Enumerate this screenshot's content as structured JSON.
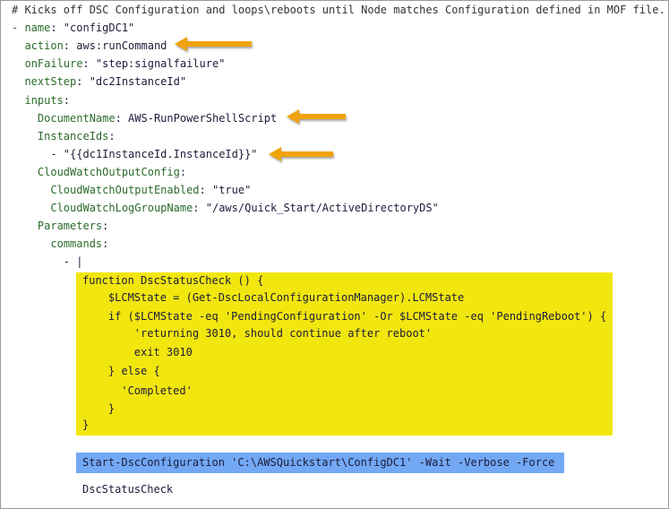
{
  "yaml_lines": [
    {
      "key": "",
      "val": "# Kicks off DSC Configuration and loops\\reboots until Node matches Configuration defined in MOF file."
    },
    {
      "key": "- name",
      "val": ": \"configDC1\""
    },
    {
      "key": "  action",
      "val": ": aws:runCommand"
    },
    {
      "key": "  onFailure",
      "val": ": \"step:signalfailure\""
    },
    {
      "key": "  nextStep",
      "val": ": \"dc2InstanceId\""
    },
    {
      "key": "  inputs",
      "val": ":"
    },
    {
      "key": "    DocumentName",
      "val": ": AWS-RunPowerShellScript"
    },
    {
      "key": "    InstanceIds",
      "val": ":"
    },
    {
      "key": "",
      "val": "      - \"{{dc1InstanceId.InstanceId}}\""
    },
    {
      "key": "    CloudWatchOutputConfig",
      "val": ":"
    },
    {
      "key": "      CloudWatchOutputEnabled",
      "val": ": \"true\""
    },
    {
      "key": "      CloudWatchLogGroupName",
      "val": ": \"/aws/Quick_Start/ActiveDirectoryDS\""
    },
    {
      "key": "    Parameters",
      "val": ":"
    },
    {
      "key": "      commands",
      "val": ":"
    },
    {
      "key": "",
      "val": "        - |"
    }
  ],
  "script_lines": [
    "function DscStatusCheck () {",
    "    $LCMState = (Get-DscLocalConfigurationManager).LCMState",
    "    if ($LCMState -eq 'PendingConfiguration' -Or $LCMState -eq 'PendingReboot') {",
    "        'returning 3010, should continue after reboot'",
    "        exit 3010",
    "    } else {",
    "      'Completed'",
    "    }",
    "}"
  ],
  "start_command": "Start-DscConfiguration 'C:\\AWSQuickstart\\ConfigDC1' -Wait -Verbose -Force",
  "final_command": "DscStatusCheck",
  "colors": {
    "highlight_yellow": "#f2e60f",
    "highlight_blue": "#73a8f5",
    "arrow": "#f0a30a",
    "key": "#2b6b2b"
  }
}
